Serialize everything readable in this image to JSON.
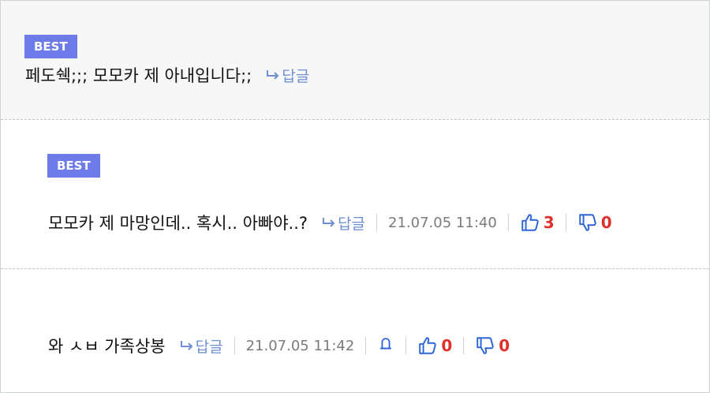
{
  "comments": [
    {
      "badge": "BEST",
      "text": "페도쉑;;; 모모카 제 아내입니다;;",
      "reply_label": "답글"
    },
    {
      "badge": "BEST",
      "text": "모모카 제 마망인데.. 혹시.. 아빠야..?",
      "reply_label": "답글",
      "date": "21.07.05 11:40",
      "upvotes": "3",
      "downvotes": "0"
    },
    {
      "text": "와 ㅅㅂ 가족상봉",
      "reply_label": "답글",
      "date": "21.07.05 11:42",
      "upvotes": "0",
      "downvotes": "0"
    }
  ],
  "icons": {
    "reply": "reply-arrow-icon",
    "upvote": "thumbs-up-icon",
    "downvote": "thumbs-down-icon",
    "alert": "bell-icon"
  },
  "colors": {
    "badge_bg": "#6d7be8",
    "reply": "#6f8fd4",
    "count": "#e0302b",
    "vote_icon": "#2f64d6"
  }
}
